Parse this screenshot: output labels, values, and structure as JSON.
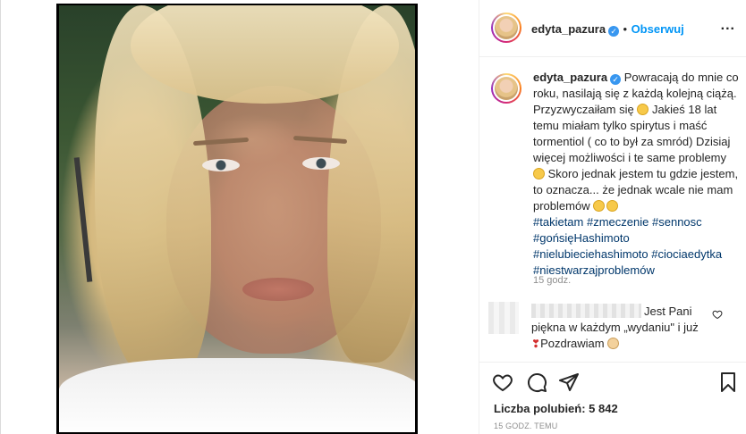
{
  "post": {
    "username": "edyta_pazura",
    "follow_label": "Obserwuj",
    "more_label": "...",
    "caption_text_1": "Powracają do mnie co roku, nasilają się z każdą kolejną ciążą. Przyzwyczaiłam się",
    "caption_text_2": "Jakieś 18 lat temu miałam tylko spirytus i maść tormentiol ( co to był za smród) Dzisiaj więcej możliwości i te same problemy",
    "caption_text_3": "Skoro jednak jestem tu gdzie jestem, to oznacza... że jednak wcale nie mam problemów",
    "hashtags": [
      "#takietam",
      "#zmeczenie",
      "#sennosc",
      "#gońsięHashimoto",
      "#nielubieciehashimoto",
      "#ciociaedytka",
      "#niestwarzajproblemów"
    ],
    "caption_age": "15 godz.",
    "comment_text": "Jest Pani piękna w każdym „wydaniu\" i już",
    "comment_text_2": "Pozdrawiam",
    "likes_label": "Liczba polubień: 5 842",
    "time_label": "15 GODZ. TEMU"
  },
  "icons": {
    "like": "heart-icon",
    "comment": "comment-icon",
    "share": "share-icon",
    "save": "bookmark-icon",
    "verified": "verified-badge-icon"
  },
  "colors": {
    "link": "#00376b",
    "follow": "#0095f6",
    "verified": "#3897f0"
  }
}
